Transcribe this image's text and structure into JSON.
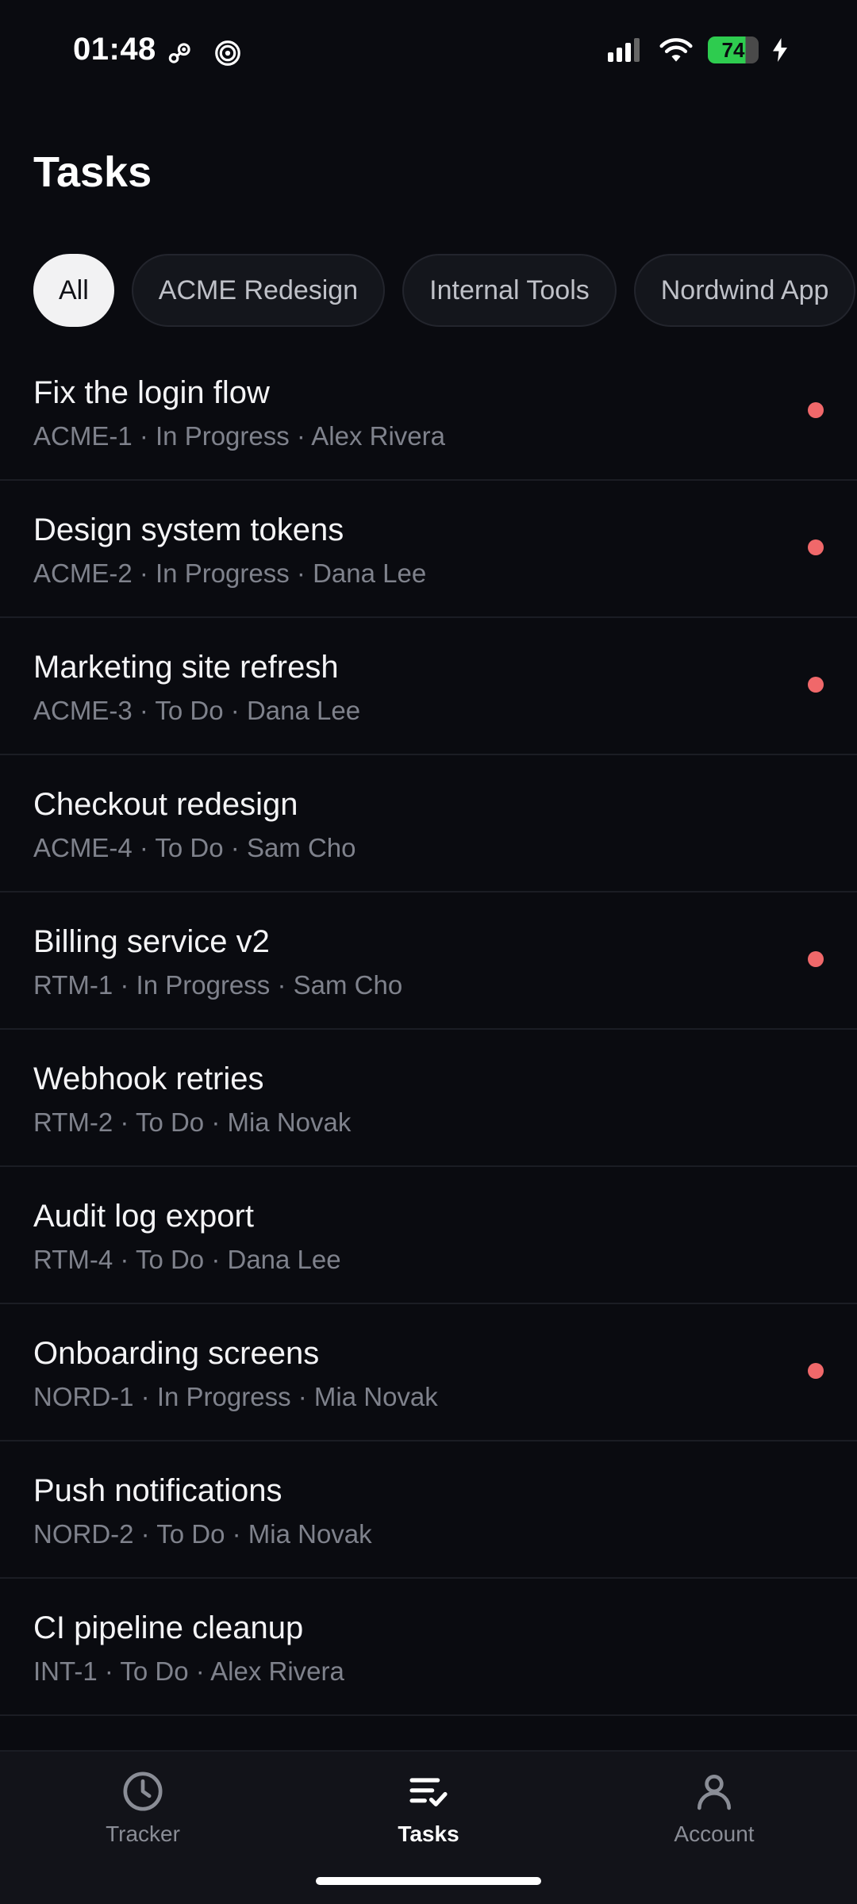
{
  "status_bar": {
    "time": "01:48",
    "battery_level": "74",
    "left_icons": [
      "steam-icon",
      "spiral-icon"
    ],
    "right_icons": [
      "signal-icon",
      "wifi-icon",
      "battery-icon",
      "charging-icon"
    ]
  },
  "header": {
    "title": "Tasks"
  },
  "filters": {
    "chips": [
      {
        "label": "All",
        "active": true
      },
      {
        "label": "ACME Redesign",
        "active": false
      },
      {
        "label": "Internal Tools",
        "active": false
      },
      {
        "label": "Nordwind App",
        "active": false
      }
    ]
  },
  "tasks": [
    {
      "title": "Fix the login flow",
      "meta": "ACME-1 · In Progress · Alex Rivera",
      "flagged": true
    },
    {
      "title": "Design system tokens",
      "meta": "ACME-2 · In Progress · Dana Lee",
      "flagged": true
    },
    {
      "title": "Marketing site refresh",
      "meta": "ACME-3 · To Do · Dana Lee",
      "flagged": true
    },
    {
      "title": "Checkout redesign",
      "meta": "ACME-4 · To Do · Sam Cho",
      "flagged": false
    },
    {
      "title": "Billing service v2",
      "meta": "RTM-1 · In Progress · Sam Cho",
      "flagged": true
    },
    {
      "title": "Webhook retries",
      "meta": "RTM-2 · To Do · Mia Novak",
      "flagged": false
    },
    {
      "title": "Audit log export",
      "meta": "RTM-4 · To Do · Dana Lee",
      "flagged": false
    },
    {
      "title": "Onboarding screens",
      "meta": "NORD-1 · In Progress · Mia Novak",
      "flagged": true
    },
    {
      "title": "Push notifications",
      "meta": "NORD-2 · To Do · Mia Novak",
      "flagged": false
    },
    {
      "title": "CI pipeline cleanup",
      "meta": "INT-1 · To Do · Alex Rivera",
      "flagged": false
    }
  ],
  "bottom_nav": {
    "items": [
      {
        "label": "Tracker",
        "icon": "clock-icon",
        "active": false
      },
      {
        "label": "Tasks",
        "icon": "task-list-icon",
        "active": true
      },
      {
        "label": "Account",
        "icon": "person-icon",
        "active": false
      }
    ]
  },
  "colors": {
    "background": "#0a0b10",
    "priority_dot": "#f0686a",
    "battery": "#2ecc4f"
  }
}
